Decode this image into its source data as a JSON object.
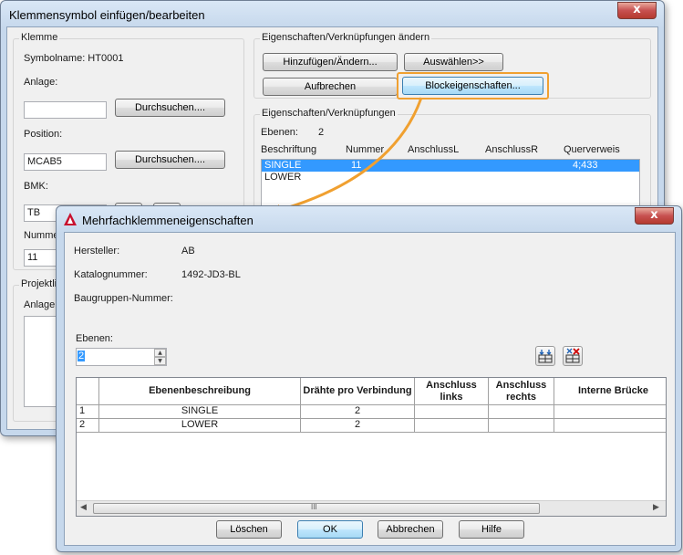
{
  "main_dialog": {
    "title": "Klemmensymbol einfügen/bearbeiten",
    "close_glyph": "x",
    "klemme": {
      "group_title": "Klemme",
      "symbolname": "Symbolname: HT0001",
      "anlage_label": "Anlage:",
      "anlage_value": "",
      "browse1": "Durchsuchen....",
      "position_label": "Position:",
      "position_value": "MCAB5",
      "browse2": "Durchsuchen....",
      "bmk_label": "BMK:",
      "bmk_value": "TB",
      "nummer_label": "Nummer",
      "nummer_value": "11",
      "projekt_label": "Projektli",
      "anlage2_label": "Anlage"
    },
    "props_change": {
      "group_title": "Eigenschaften/Verknüpfungen ändern",
      "add_change": "Hinzufügen/Ändern...",
      "select": "Auswählen>>",
      "break": "Aufbrechen",
      "block_props": "Blockeigenschaften..."
    },
    "props": {
      "group_title": "Eigenschaften/Verknüpfungen",
      "ebenen_label": "Ebenen:",
      "ebenen_value": "2",
      "columns": [
        "Beschriftung",
        "Nummer",
        "AnschlussL",
        "AnschlussR",
        "Querverweis"
      ],
      "rows": [
        {
          "beschriftung": "SINGLE",
          "nummer": "11",
          "querverweis": "4;433",
          "selected": true
        },
        {
          "beschriftung": "LOWER",
          "nummer": "",
          "querverweis": "",
          "selected": false
        }
      ]
    }
  },
  "sub_dialog": {
    "title": "Mehrfachklemmeneigenschaften",
    "close_glyph": "x",
    "hersteller_label": "Hersteller:",
    "hersteller_value": "AB",
    "katalog_label": "Katalognummer:",
    "katalog_value": "1492-JD3-BL",
    "baugruppe_label": "Baugruppen-Nummer:",
    "ebenen_label": "Ebenen:",
    "ebenen_value": "2",
    "table": {
      "headers": [
        "Ebenenbeschreibung",
        "Drähte pro Verbindung",
        "Anschluss links",
        "Anschluss rechts",
        "Interne Brücke"
      ],
      "rows": [
        {
          "num": "1",
          "desc": "SINGLE",
          "wires": "2"
        },
        {
          "num": "2",
          "desc": "LOWER",
          "wires": "2"
        }
      ]
    },
    "scroll_thumb": "III",
    "buttons": {
      "delete": "Löschen",
      "ok": "OK",
      "cancel": "Abbrechen",
      "help": "Hilfe"
    }
  },
  "colors": {
    "highlight": "#f0a030",
    "selection": "#3399ff",
    "close_red": "#c75050"
  }
}
